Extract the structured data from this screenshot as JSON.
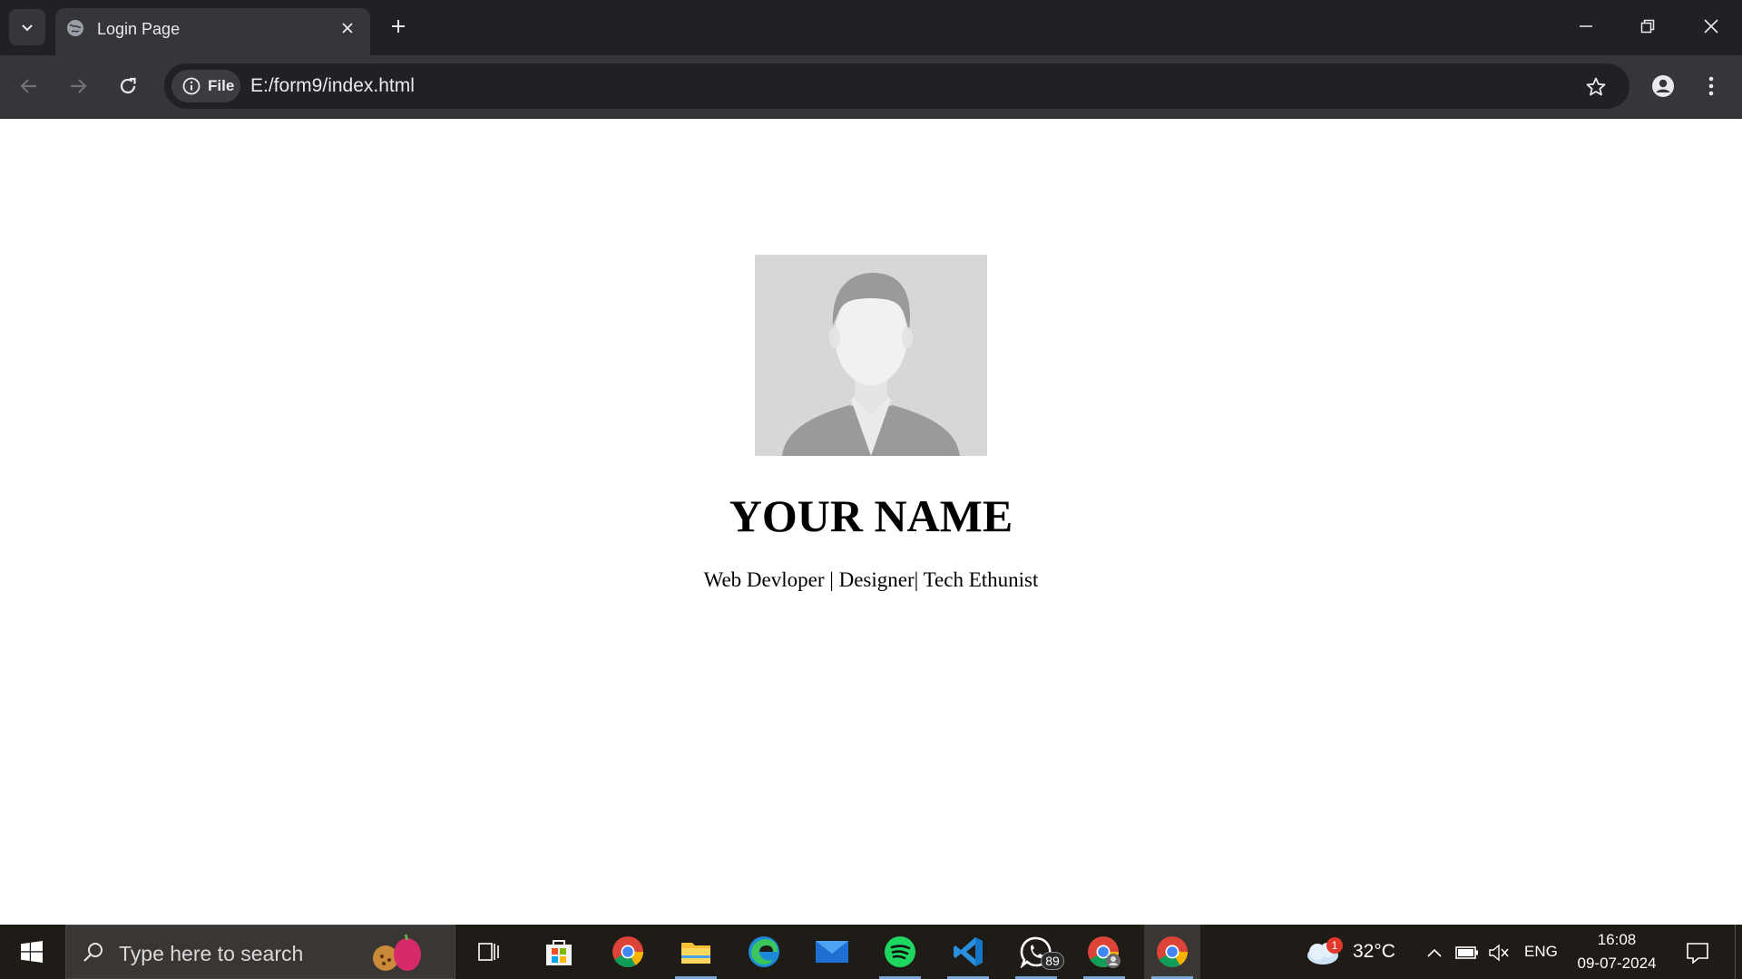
{
  "browser": {
    "tab": {
      "title": "Login Page"
    },
    "address_bar": {
      "chip_label": "File",
      "url": "E:/form9/index.html"
    }
  },
  "page": {
    "profile": {
      "name": "YOUR NAME",
      "tagline": "Web Devloper | Designer| Tech Ethunist"
    }
  },
  "taskbar": {
    "search_placeholder": "Type here to search",
    "apps": [
      "task-view",
      "microsoft-store",
      "google-chrome",
      "file-explorer",
      "microsoft-edge",
      "mail",
      "spotify",
      "visual-studio-code",
      "whatsapp",
      "chrome-profile",
      "google-chrome-active"
    ],
    "whatsapp_badge": "89",
    "weather": {
      "badge": "1",
      "temperature": "32°C"
    },
    "language": "ENG",
    "time": "16:08",
    "date": "09-07-2024"
  }
}
